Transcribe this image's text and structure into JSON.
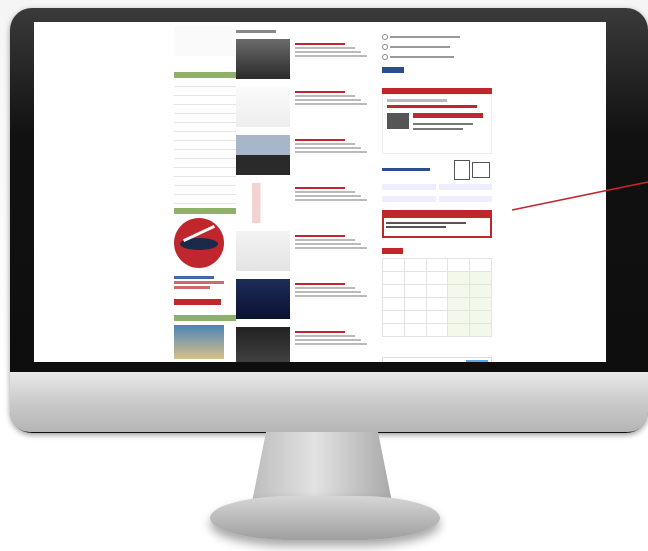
{
  "colors": {
    "accent": "#c0272d",
    "green": "#4a9a2e",
    "navy": "#2b4e8c"
  },
  "left_nav": {
    "items": [
      "",
      "",
      "",
      "",
      "",
      "",
      "",
      "",
      "",
      "",
      "",
      "",
      "",
      ""
    ]
  },
  "articles": [
    {
      "thumb": "man-portrait",
      "title": "",
      "lines": 3
    },
    {
      "thumb": "line-chart",
      "title": "",
      "lines": 3
    },
    {
      "thumb": "city-skyline",
      "title": "",
      "lines": 3
    },
    {
      "thumb": "bar-chart",
      "title": "",
      "lines": 3
    },
    {
      "thumb": "stock-chart",
      "title": "",
      "lines": 3
    },
    {
      "thumb": "trading-room",
      "title": "",
      "lines": 3
    },
    {
      "thumb": "skyline-night",
      "title": "",
      "lines": 3
    }
  ],
  "right": {
    "radio_options": [
      "",
      "",
      ""
    ],
    "vote_label": "",
    "table_rows": 5
  }
}
